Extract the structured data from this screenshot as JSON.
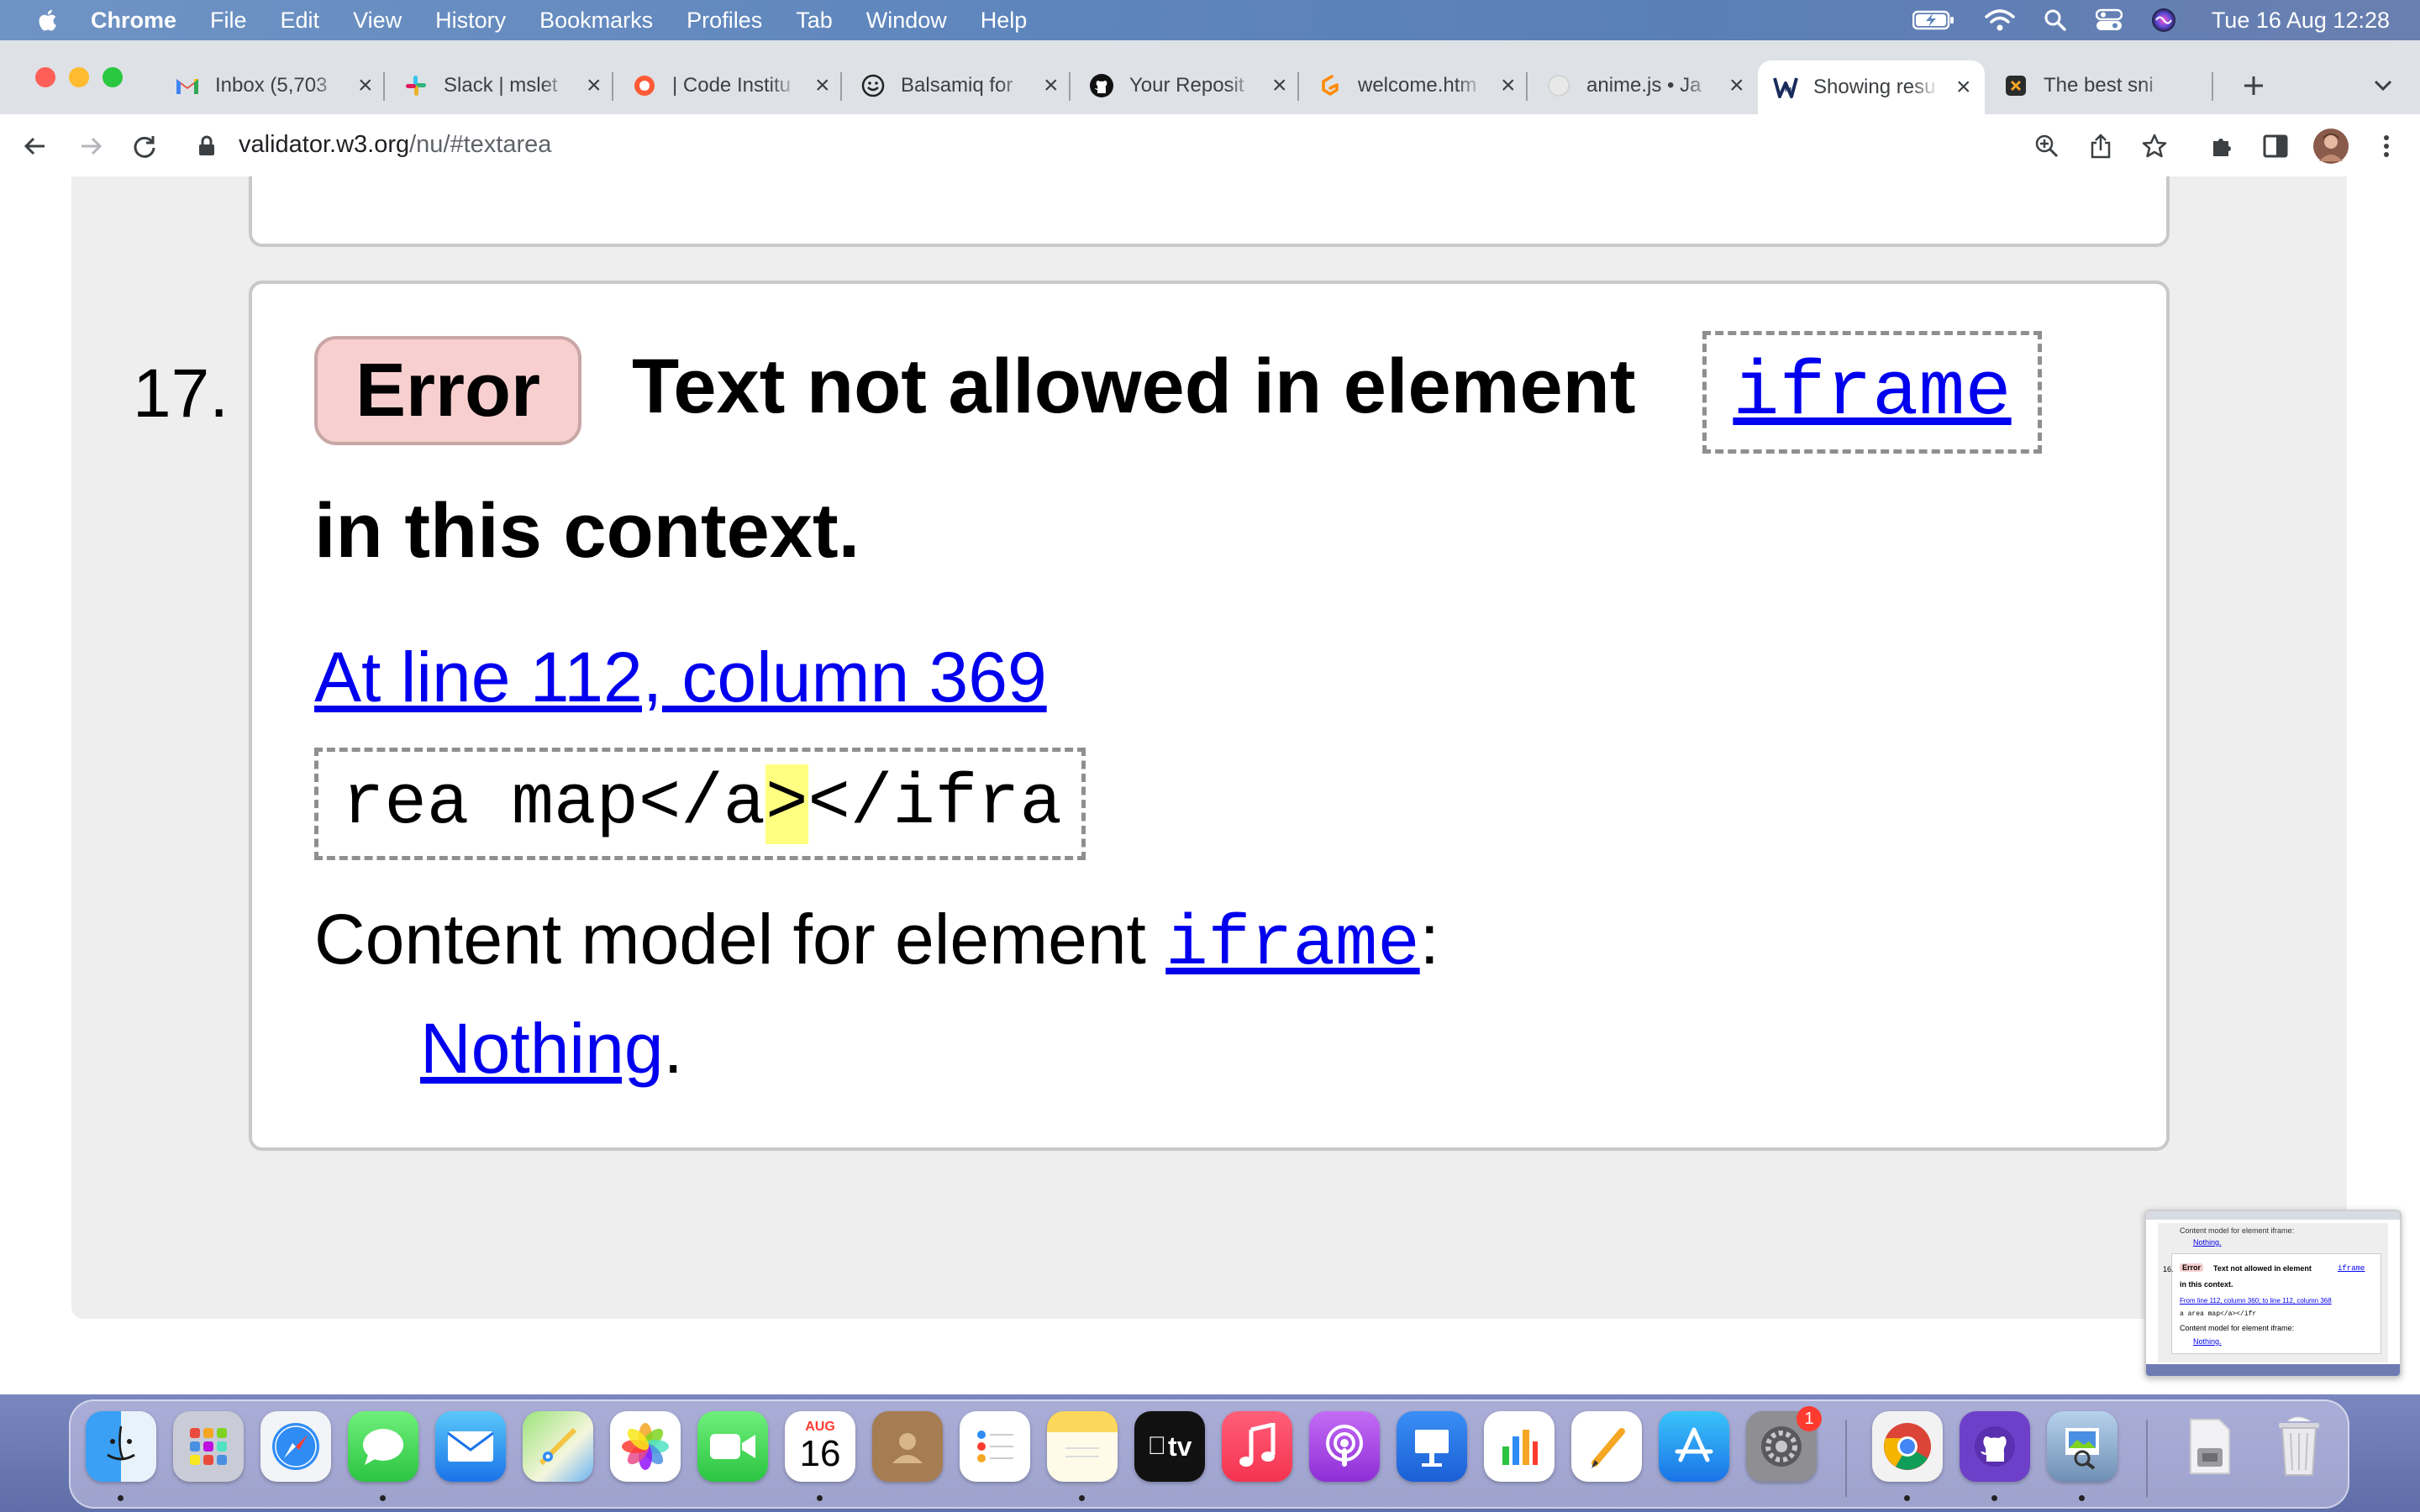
{
  "menubar": {
    "app": "Chrome",
    "items": [
      "File",
      "Edit",
      "View",
      "History",
      "Bookmarks",
      "Profiles",
      "Tab",
      "Window",
      "Help"
    ],
    "clock": "Tue 16 Aug  12:28"
  },
  "tabs": [
    {
      "title": "Inbox (5,703",
      "icon": "gmail-icon"
    },
    {
      "title": "Slack | mslet",
      "icon": "slack-icon"
    },
    {
      "title": "| Code Institu",
      "icon": "code-institute-icon"
    },
    {
      "title": "Balsamiq for",
      "icon": "balsamiq-icon"
    },
    {
      "title": "Your Reposit",
      "icon": "github-icon"
    },
    {
      "title": "welcome.htm",
      "icon": "gitpod-icon"
    },
    {
      "title": "anime.js • Ja",
      "icon": "animejs-icon"
    },
    {
      "title": "Showing resu",
      "icon": "w3c-validator-icon",
      "active": true
    },
    {
      "title": "The best sni",
      "icon": "snippet-icon"
    }
  ],
  "toolbar": {
    "url_host": "validator.w3.org",
    "url_path": "/nu/#textarea"
  },
  "message": {
    "number": "17.",
    "type": "Error",
    "text_part1": "Text not allowed in element",
    "element": "iframe",
    "text_part2": "in this context.",
    "location": "At line 112, column 369",
    "extract_before": "rea map</a",
    "extract_highlight": ">",
    "extract_after": "</ifra",
    "content_model_label": "Content model for element",
    "content_model_element": "iframe",
    "content_model_colon": ":",
    "content_model_value": "Nothing",
    "content_model_period": "."
  },
  "thumbnail": {
    "line0": "Content model for element iframe:",
    "line1": "Nothing.",
    "number": "16.",
    "badge": "Error",
    "text": "Text not allowed in element",
    "element": "iframe",
    "text2": "in this context.",
    "location": "From line 112, column 360; to line 112, column 368",
    "extract": "a area map</a></ifr",
    "cm": "Content model for element iframe:",
    "nothing": "Nothing."
  },
  "dock": {
    "calendar_month": "AUG",
    "calendar_day": "16",
    "settings_badge": "1",
    "tv_label": "tv"
  },
  "colors": {
    "error_badge": "#f7cfcf",
    "link": "#0000ee",
    "highlight": "#ffff80"
  }
}
